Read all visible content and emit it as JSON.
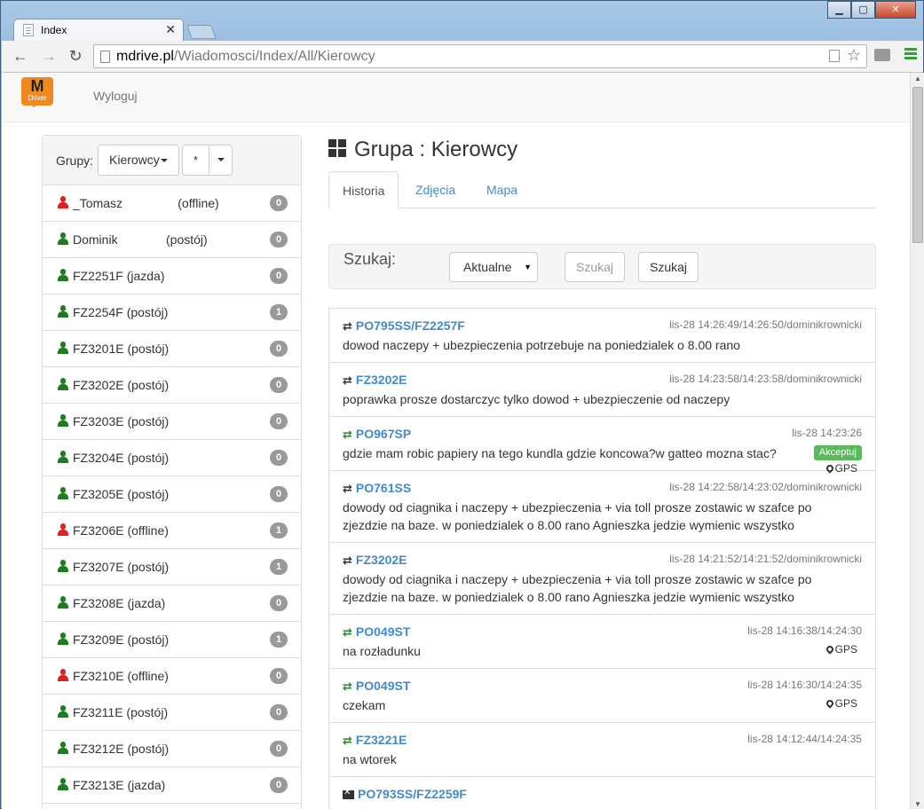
{
  "browser": {
    "tab_title": "Index",
    "tab_close": "✕",
    "url_host": "mdrive.pl",
    "url_path": "/Wiadomosci/Index/All/Kierowcy"
  },
  "nav": {
    "logo_text": "M",
    "logo_sub": "Driver",
    "logout": "Wyloguj"
  },
  "groups": {
    "label": "Grupy:",
    "selected": "Kierowcy",
    "filter": "*"
  },
  "drivers": [
    {
      "name": "_Tomasz                (offline)",
      "status": "red",
      "count": "0"
    },
    {
      "name": "Dominik              (postój)",
      "status": "green",
      "count": "0"
    },
    {
      "name": "FZ2251F (jazda)",
      "status": "green",
      "count": "0"
    },
    {
      "name": "FZ2254F (postój)",
      "status": "green",
      "count": "1"
    },
    {
      "name": "FZ3201E (postój)",
      "status": "green",
      "count": "0"
    },
    {
      "name": "FZ3202E (postój)",
      "status": "green",
      "count": "0"
    },
    {
      "name": "FZ3203E (postój)",
      "status": "green",
      "count": "0"
    },
    {
      "name": "FZ3204E (postój)",
      "status": "green",
      "count": "0"
    },
    {
      "name": "FZ3205E (postój)",
      "status": "green",
      "count": "0"
    },
    {
      "name": "FZ3206E (offline)",
      "status": "red",
      "count": "1"
    },
    {
      "name": "FZ3207E (postój)",
      "status": "green",
      "count": "1"
    },
    {
      "name": "FZ3208E (jazda)",
      "status": "green",
      "count": "0"
    },
    {
      "name": "FZ3209E (postój)",
      "status": "green",
      "count": "1"
    },
    {
      "name": "FZ3210E (offline)",
      "status": "red",
      "count": "0"
    },
    {
      "name": "FZ3211E (postój)",
      "status": "green",
      "count": "0"
    },
    {
      "name": "FZ3212E (postój)",
      "status": "green",
      "count": "0"
    },
    {
      "name": "FZ3213E (jazda)",
      "status": "green",
      "count": "0"
    }
  ],
  "main": {
    "title": "Grupa : Kierowcy",
    "tabs": [
      "Historia",
      "Zdjęcia",
      "Mapa"
    ],
    "search_label": "Szukaj:",
    "select_value": "Aktualne",
    "search_ghost": "Szukaj",
    "search_button": "Szukaj"
  },
  "messages": [
    {
      "vehicle": "PO795SS/FZ2257F",
      "icon": "exchange",
      "time": "lis-28 14:26:49/14:26:50/dominikrownicki",
      "text": "dowod naczepy + ubezpieczenia potrzebuje na poniedzialek o 8.00 rano",
      "h": 61
    },
    {
      "vehicle": "FZ3202E",
      "icon": "exchange",
      "time": "lis-28 14:23:58/14:23:58/dominikrownicki",
      "text": "poprawka prosze dostarczyc tylko dowod + ubezpieczenie od naczepy",
      "h": 61
    },
    {
      "vehicle": "PO967SP",
      "icon": "exchange-green",
      "time": "lis-28 14:23:26",
      "text": "gdzie mam robic papiery na tego kundla gdzie koncowa?w gatteo mozna stac?",
      "accept": "Akceptuj",
      "gps": "GPS",
      "h": 61
    },
    {
      "vehicle": "PO761SS",
      "icon": "exchange",
      "time": "lis-28 14:22:58/14:23:02/dominikrownicki",
      "text": "dowody od ciagnika i naczepy + ubezpieczenia + via toll prosze zostawic w szafce po zjezdzie na baze. w poniedzialek o 8.00 rano Agnieszka jedzie wymienic wszystko",
      "h": 81
    },
    {
      "vehicle": "FZ3202E",
      "icon": "exchange",
      "time": "lis-28 14:21:52/14:21:52/dominikrownicki",
      "text": "dowody od ciagnika i naczepy + ubezpieczenia + via toll prosze zostawic w szafce po zjezdzie na baze. w poniedzialek o 8.00 rano Agnieszka jedzie wymienic wszystko",
      "h": 81
    },
    {
      "vehicle": "PO049ST",
      "icon": "exchange-green",
      "time": "lis-28 14:16:38/14:24:30",
      "text": "na rozładunku",
      "gps": "GPS",
      "h": 61
    },
    {
      "vehicle": "PO049ST",
      "icon": "exchange-green",
      "time": "lis-28 14:16:30/14:24:35",
      "text": "czekam",
      "gps": "GPS",
      "h": 61
    },
    {
      "vehicle": "FZ3221E",
      "icon": "exchange-green",
      "time": "lis-28 14:12:44/14:24:35",
      "text": "na wtorek",
      "h": 61
    },
    {
      "vehicle": "PO793SS/FZ2259F",
      "icon": "envelope",
      "time": "",
      "text": "",
      "h": 61
    }
  ]
}
